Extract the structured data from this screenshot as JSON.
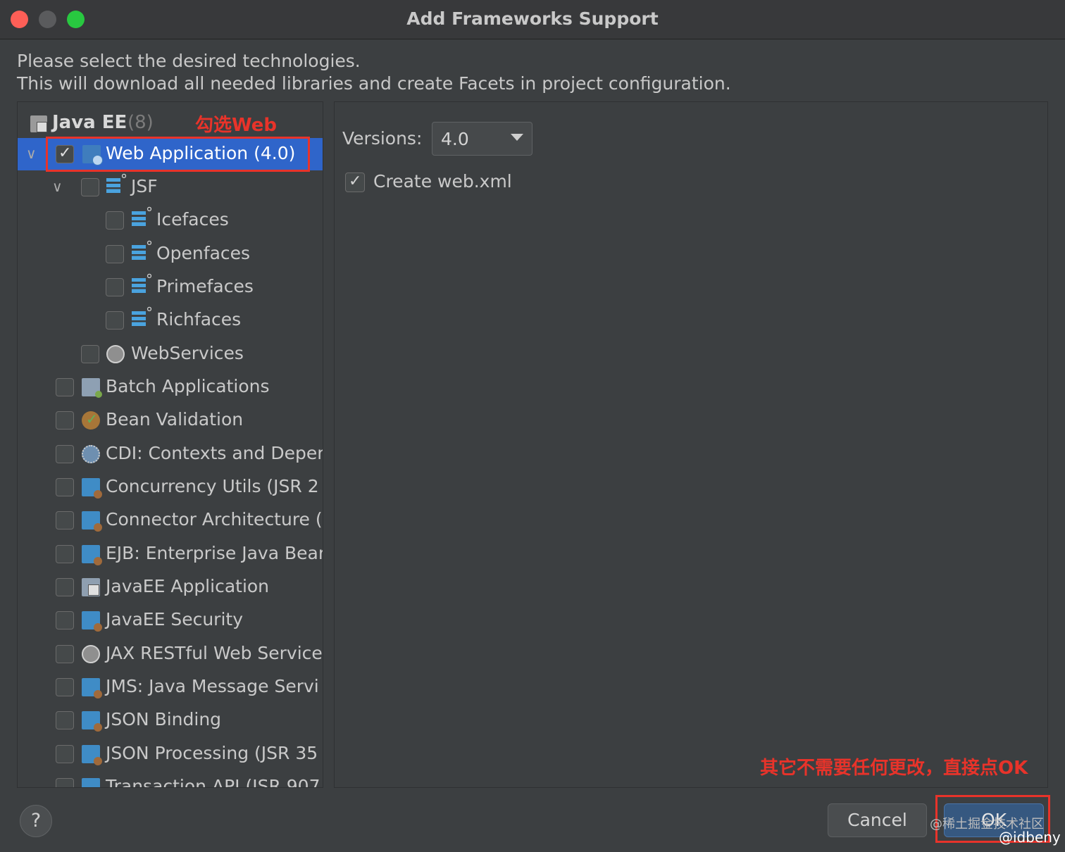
{
  "window": {
    "title": "Add Frameworks Support"
  },
  "description": {
    "line1": "Please select the desired technologies.",
    "line2": "This will download all needed libraries and create Facets in project configuration."
  },
  "tree": {
    "group_label": "Java EE",
    "group_count": "(8)",
    "items": [
      {
        "label": "Web Application (4.0)",
        "checked": true,
        "icon": "web-module-icon"
      },
      {
        "label": "JSF",
        "checked": false,
        "icon": "jsf-icon"
      },
      {
        "label": "Icefaces",
        "checked": false,
        "icon": "jsf-icon"
      },
      {
        "label": "Openfaces",
        "checked": false,
        "icon": "jsf-icon"
      },
      {
        "label": "Primefaces",
        "checked": false,
        "icon": "jsf-icon"
      },
      {
        "label": "Richfaces",
        "checked": false,
        "icon": "jsf-icon"
      },
      {
        "label": "WebServices",
        "checked": false,
        "icon": "globe-icon"
      },
      {
        "label": "Batch Applications",
        "checked": false,
        "icon": "batch-folder-icon"
      },
      {
        "label": "Bean Validation",
        "checked": false,
        "icon": "bean-validation-icon"
      },
      {
        "label": "CDI: Contexts and Depen",
        "checked": false,
        "icon": "cdi-icon"
      },
      {
        "label": "Concurrency Utils (JSR 2",
        "checked": false,
        "icon": "module-icon"
      },
      {
        "label": "Connector Architecture (.",
        "checked": false,
        "icon": "module-icon"
      },
      {
        "label": "EJB: Enterprise Java Bear",
        "checked": false,
        "icon": "module-icon"
      },
      {
        "label": "JavaEE Application",
        "checked": false,
        "icon": "javaee-app-icon"
      },
      {
        "label": "JavaEE Security",
        "checked": false,
        "icon": "module-icon"
      },
      {
        "label": "JAX RESTful Web Service",
        "checked": false,
        "icon": "globe-icon"
      },
      {
        "label": "JMS: Java Message Servi",
        "checked": false,
        "icon": "module-icon"
      },
      {
        "label": "JSON Binding",
        "checked": false,
        "icon": "module-icon"
      },
      {
        "label": "JSON Processing (JSR 35",
        "checked": false,
        "icon": "module-icon"
      },
      {
        "label": "Transaction API (JSR 907",
        "checked": false,
        "icon": "module-icon"
      }
    ]
  },
  "annotations": {
    "top": "勾选Web",
    "bottom": "其它不需要任何更改，直接点OK"
  },
  "details": {
    "versions_label": "Versions:",
    "version_value": "4.0",
    "create_xml_label": "Create web.xml",
    "create_xml_checked": true
  },
  "buttons": {
    "help": "?",
    "cancel": "Cancel",
    "ok": "OK"
  },
  "watermark": {
    "line1": "@稀土掘金技术社区",
    "line2": "@idbeny"
  },
  "colors": {
    "selection": "#2f65ca",
    "annotation": "#e8332a",
    "dialog_bg": "#3c3f41"
  }
}
